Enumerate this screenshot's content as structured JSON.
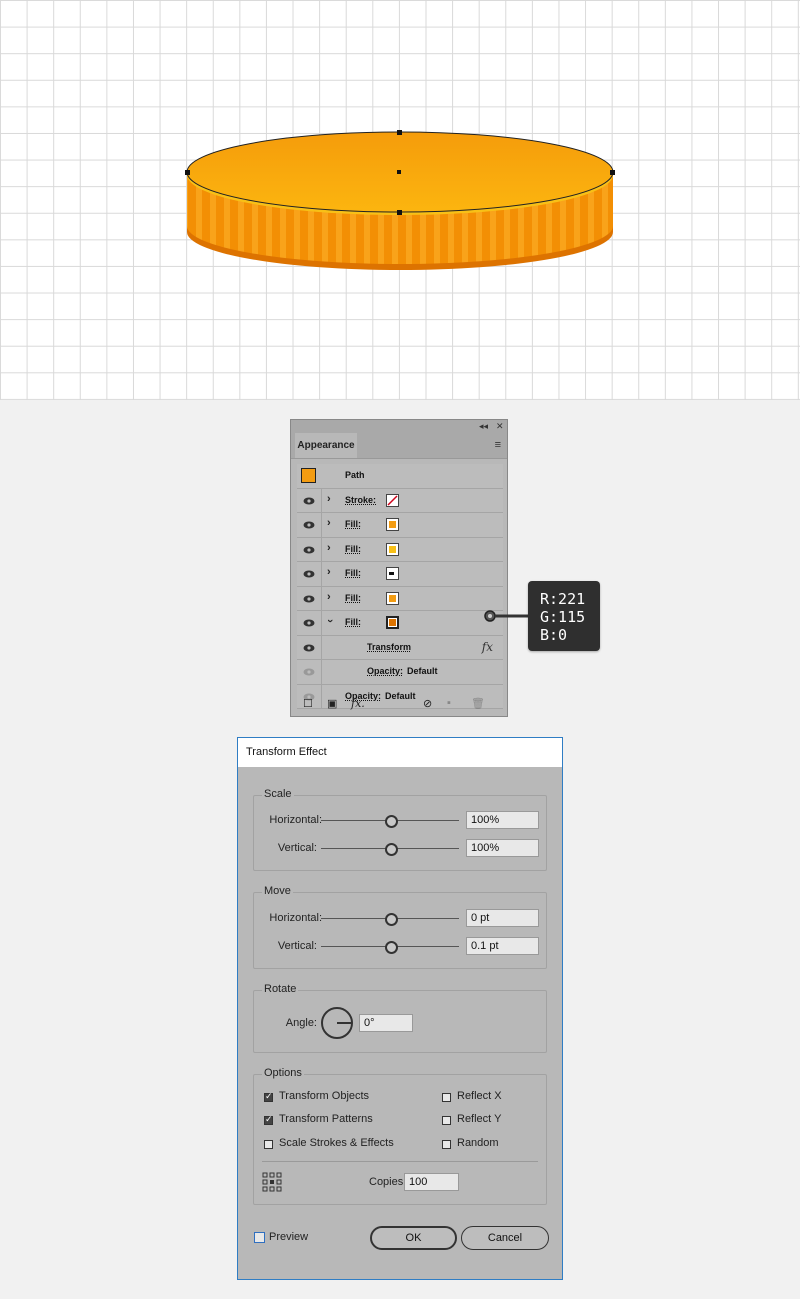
{
  "canvas": {
    "colors": {
      "top": "#fbab0d",
      "side": "#f38f04",
      "side_dark": "#dd7300",
      "rim": "#f8c017"
    }
  },
  "appearance_panel": {
    "tab_label": "Appearance",
    "collapse_icon": "double-chevron-left-icon",
    "close_icon": "close-icon",
    "menu_icon": "panel-menu-icon",
    "object_label": "Path",
    "rows": [
      {
        "label": "Stroke:",
        "swatch": "none-stroke",
        "expanded": false
      },
      {
        "label": "Fill:",
        "swatch": "#f39c12",
        "expanded": false
      },
      {
        "label": "Fill:",
        "swatch": "#f8c017",
        "expanded": false
      },
      {
        "label": "Fill:",
        "swatch": "pattern-white",
        "expanded": false
      },
      {
        "label": "Fill:",
        "swatch": "#f39c12",
        "expanded": false
      },
      {
        "label": "Fill:",
        "swatch": "#dd7300",
        "expanded": true
      }
    ],
    "transform_label": "Transform",
    "fx_label": "fx",
    "opacity_label": "Opacity:",
    "opacity_value": "Default",
    "path_opacity_label": "Opacity:",
    "path_opacity_value": "Default"
  },
  "tooltip": {
    "r": "R:221",
    "g": "G:115",
    "b": "B:0"
  },
  "dialog": {
    "title": "Transform Effect",
    "scale": {
      "title": "Scale",
      "horizontal_label": "Horizontal:",
      "horizontal_value": "100%",
      "vertical_label": "Vertical:",
      "vertical_value": "100%"
    },
    "move": {
      "title": "Move",
      "horizontal_label": "Horizontal:",
      "horizontal_value": "0 pt",
      "vertical_label": "Vertical:",
      "vertical_value": "0.1 pt"
    },
    "rotate": {
      "title": "Rotate",
      "angle_label": "Angle:",
      "angle_value": "0°"
    },
    "options": {
      "title": "Options",
      "transform_objects": "Transform Objects",
      "transform_patterns": "Transform Patterns",
      "scale_strokes": "Scale Strokes & Effects",
      "reflect_x": "Reflect X",
      "reflect_y": "Reflect Y",
      "random": "Random",
      "copies_label": "Copies",
      "copies_value": "100"
    },
    "preview_label": "Preview",
    "ok_label": "OK",
    "cancel_label": "Cancel"
  }
}
